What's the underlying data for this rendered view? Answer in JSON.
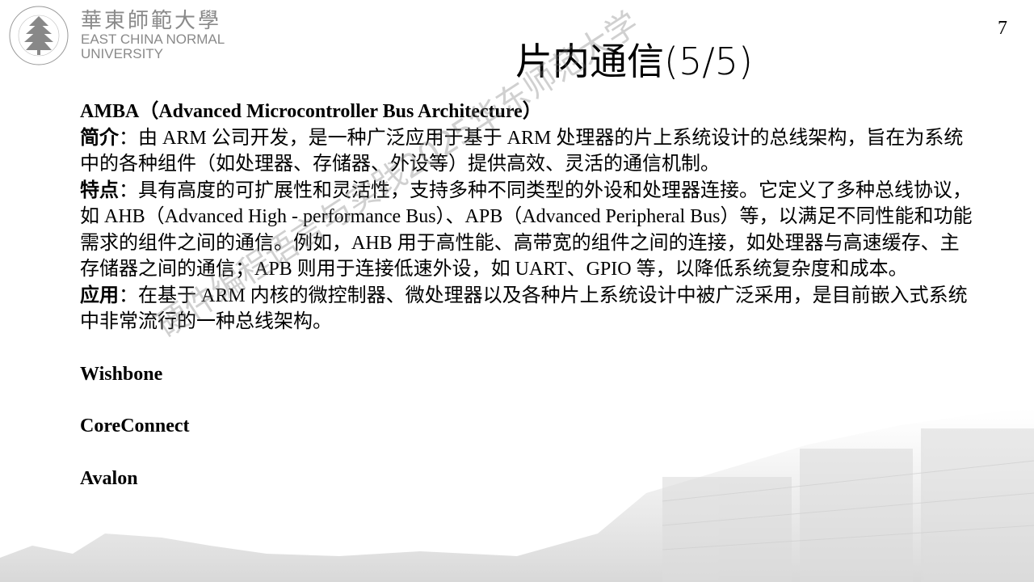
{
  "logo": {
    "name_cn": "華東師範大學",
    "name_en_line1": "EAST CHINA NORMAL",
    "name_en_line2": "UNIVERSITY",
    "seal_text": "EAST CHINA NORMAL UNIVERSITY"
  },
  "page_number": "7",
  "title": "片内通信(5/5)",
  "amba": {
    "heading": "AMBA（Advanced Microcontroller Bus Architecture）",
    "intro_label": "简介",
    "intro_text": "：由 ARM 公司开发，是一种广泛应用于基于 ARM 处理器的片上系统设计的总线架构，旨在为系统中的各种组件（如处理器、存储器、外设等）提供高效、灵活的通信机制。",
    "features_label": "特点",
    "features_text": "：具有高度的可扩展性和灵活性，支持多种不同类型的外设和处理器连接。它定义了多种总线协议，如 AHB（Advanced High - performance Bus）、APB（Advanced Peripheral Bus）等，以满足不同性能和功能需求的组件之间的通信。例如，AHB 用于高性能、高带宽的组件之间的连接，如处理器与高速缓存、主存储器之间的通信；APB 则用于连接低速外设，如 UART、GPIO 等，以降低系统复杂度和成本。",
    "application_label": "应用",
    "application_text": "：在基于 ARM 内核的微控制器、微处理器以及各种片上系统设计中被广泛采用，是目前嵌入式系统中非常流行的一种总线架构。"
  },
  "other_buses": [
    "Wishbone",
    "CoreConnect",
    "Avalon"
  ],
  "watermark": "硬件编程语言与实践2025华东师范大学"
}
